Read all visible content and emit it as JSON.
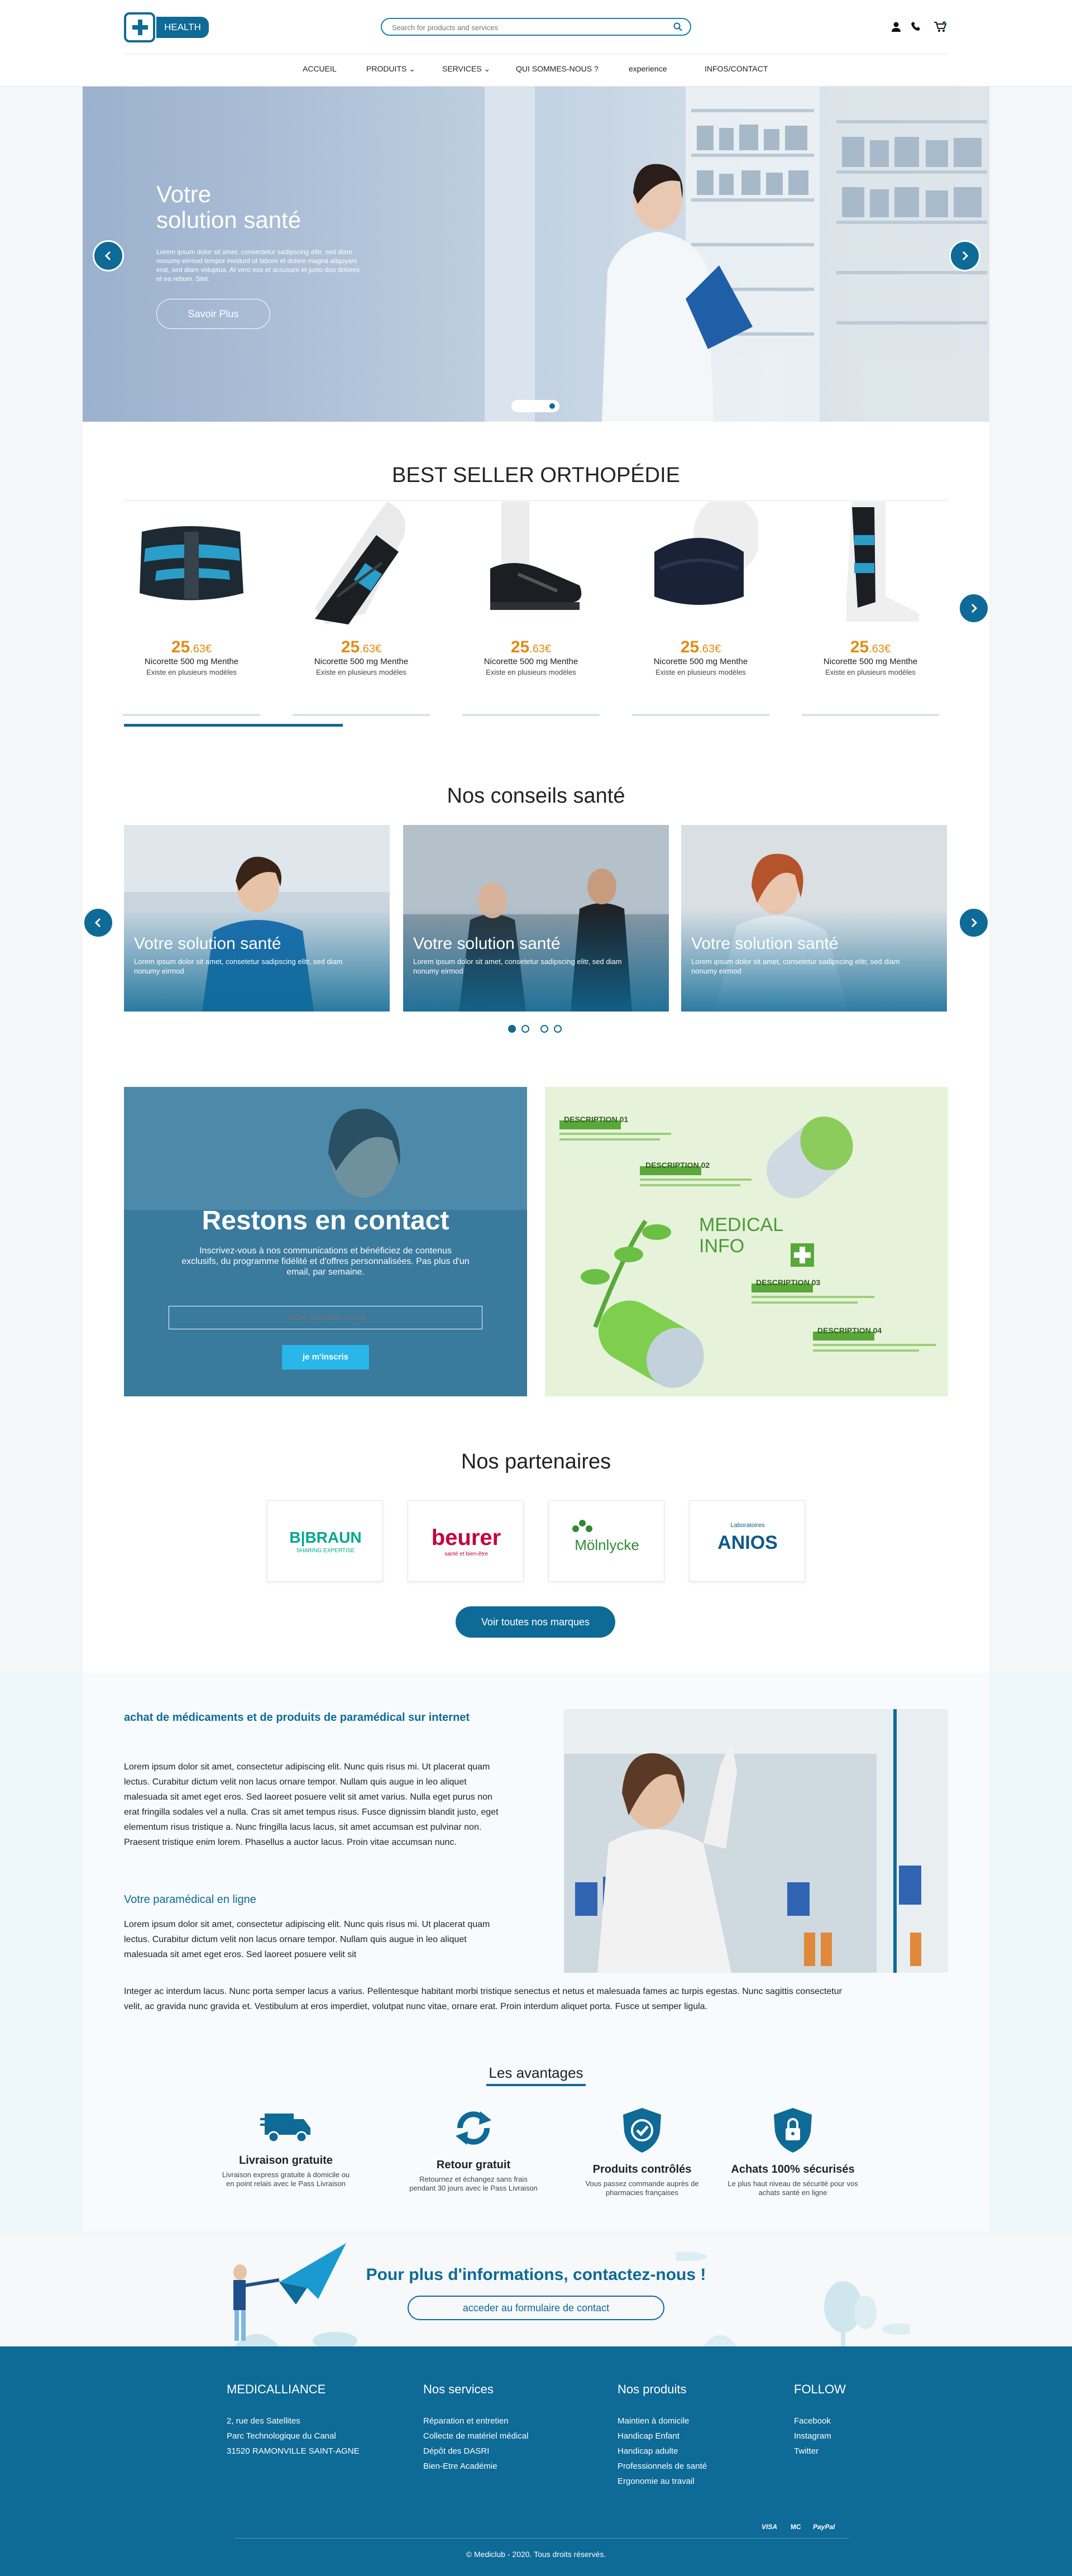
{
  "header": {
    "logo_text": "HEALTH",
    "search_placeholder": "Search for products and services",
    "icons": [
      "user-icon",
      "phone-icon",
      "cart-icon"
    ],
    "nav": [
      "ACCUEIL",
      "PRODUITS",
      "SERVICES",
      "QUI SOMMES-NOUS ?",
      "experience",
      "INFOS/CONTACT"
    ]
  },
  "hero": {
    "title_line1": "Votre",
    "title_line2": "solution santé",
    "text": "Lorem ipsum dolor sit amet, consectetur sadipscing elitr, sed diam nonumy eirmod tempor invidunt ut labore et dolore magna aliquyam erat, sed diam voluptua. At vero eos et accusam et justo duo dolores et ea rebum. Stet.",
    "button": "Savoir Plus"
  },
  "bestseller": {
    "title": "BEST SELLER ORTHOPÉDIE",
    "products": [
      {
        "price_int": "25",
        "price_dec": ".63€",
        "name": "Nicorette 500 mg Menthe",
        "sub": "Existe en plusieurs modèles",
        "image": "lumbar-belt"
      },
      {
        "price_int": "25",
        "price_dec": ".63€",
        "name": "Nicorette 500 mg Menthe",
        "sub": "Existe en plusieurs modèles",
        "image": "wrist-brace"
      },
      {
        "price_int": "25",
        "price_dec": ".63€",
        "name": "Nicorette 500 mg Menthe",
        "sub": "Existe en plusieurs modèles",
        "image": "post-op-shoe"
      },
      {
        "price_int": "25",
        "price_dec": ".63€",
        "name": "Nicorette 500 mg Menthe",
        "sub": "Existe en plusieurs modèles",
        "image": "cervical-collar"
      },
      {
        "price_int": "25",
        "price_dec": ".63€",
        "name": "Nicorette 500 mg Menthe",
        "sub": "Existe en plusieurs modèles",
        "image": "ankle-brace"
      }
    ]
  },
  "conseils": {
    "title": "Nos conseils santé",
    "cards": [
      {
        "title": "Votre solution santé",
        "text": "Lorem ipsum dolor sit amet, consetetur sadipscing elitr, sed diam nonumy eirmod"
      },
      {
        "title": "Votre solution santé",
        "text": "Lorem ipsum dolor sit amet, consetetur sadipscing elitr, sed diam nonumy eirmod"
      },
      {
        "title": "Votre solution santé",
        "text": "Lorem ipsum dolor sit amet, consetetur sadipscing elitr, sed diam nonumy eirmod"
      }
    ]
  },
  "contact": {
    "title": "Restons en contact",
    "text": "Inscrivez-vous à nos communications et bénéficiez de contenus exclusifs, du programme fidélité et d'offres personnalisées. Pas plus d'un email, par semaine.",
    "email_placeholder": "Votre adresse email",
    "button": "je m'inscris"
  },
  "medical_info": {
    "title_line1": "MEDICAL",
    "title_line2": "INFO",
    "descriptions": [
      "DESCRIPTION 01",
      "DESCRIPTION 02",
      "DESCRIPTION 03",
      "DESCRIPTION 04"
    ]
  },
  "partners": {
    "title": "Nos partenaires",
    "brands": [
      {
        "name": "B|BRAUN",
        "tagline": "SHARING EXPERTISE",
        "color": "#00a78e"
      },
      {
        "name": "beurer",
        "tagline": "santé et bien-être",
        "color": "#c3003e"
      },
      {
        "name": "Mölnlycke",
        "tagline": "",
        "color": "#2f8a34"
      },
      {
        "name": "ANIOS",
        "tagline": "Laboratoires",
        "color": "#0e5a8a"
      }
    ],
    "button": "Voir toutes nos marques"
  },
  "about": {
    "heading": "achat de médicaments et de produits de paramédical sur internet",
    "para1": "Lorem ipsum dolor sit amet, consectetur adipiscing elit. Nunc quis risus mi. Ut placerat quam lectus. Curabitur dictum velit non lacus ornare tempor. Nullam quis augue in leo aliquet malesuada sit amet eget eros. Sed laoreet posuere velit sit amet varius. Nulla eget purus non erat fringilla sodales vel a nulla. Cras sit amet tempus risus. Fusce dignissim blandit justo, eget elementum risus tristique a. Nunc fringilla lacus lacus, sit amet accumsan est pulvinar non. Praesent tristique enim lorem. Phasellus a auctor lacus. Proin vitae accumsan nunc.",
    "subheading": "Votre paramédical  en ligne",
    "para2": "Lorem ipsum dolor sit amet, consectetur adipiscing elit. Nunc quis risus mi. Ut placerat quam lectus. Curabitur dictum velit non lacus ornare tempor. Nullam quis augue in leo aliquet malesuada sit amet eget eros. Sed laoreet posuere velit sit",
    "para3": "Integer ac interdum lacus. Nunc porta semper lacus a varius. Pellentesque habitant morbi tristique senectus et netus et malesuada fames ac turpis egestas. Nunc sagittis consectetur velit, ac gravida nunc gravida et. Vestibulum at eros imperdiet, volutpat nunc vitae, ornare erat. Proin interdum aliquet porta. Fusce ut semper ligula."
  },
  "avantages": {
    "title": "Les avantages",
    "items": [
      {
        "icon": "truck-icon",
        "title": "Livraison gratuite",
        "text": "Livraison express gratuite à domicile ou en point relais avec le Pass Livraison"
      },
      {
        "icon": "refresh-icon",
        "title": "Retour gratuit",
        "text": "Retournez et échangez sans frais pendant 30 jours avec le Pass Livraison"
      },
      {
        "icon": "shield-check-icon",
        "title": "Produits contrôlés",
        "text": "Vous passez commande auprès de pharmacies françaises"
      },
      {
        "icon": "lock-icon",
        "title": "Achats 100% sécurisés",
        "text": "Le plus haut niveau de sécurité pour vos achats santé en ligne"
      }
    ]
  },
  "cta": {
    "title": "Pour plus d'informations, contactez-nous !",
    "button": "acceder au formulaire de contact"
  },
  "footer": {
    "col1": {
      "title": "MEDICALLIANCE",
      "lines": [
        "2, rue des Satellites",
        "Parc Technologique du Canal",
        "31520 RAMONVILLE SAINT-AGNE"
      ]
    },
    "col2": {
      "title": "Nos services",
      "links": [
        "Réparation et entretien",
        "Collecte de matériel médical",
        "Dépôt des DASRI",
        "Bien-Etre Académie"
      ]
    },
    "col3": {
      "title": "Nos produits",
      "links": [
        "Maintien à domicile",
        "Handicap Enfant",
        "Handicap adulte",
        "Professionnels de santé",
        "Ergonomie au travail"
      ]
    },
    "col4": {
      "title": "FOLLOW",
      "links": [
        "Facebook",
        "Instagram",
        "Twitter"
      ]
    },
    "payments": [
      "VISA",
      "MC",
      "PayPal"
    ],
    "copyright": "© Mediclub - 2020. Tous droits réservés."
  },
  "colors": {
    "primary": "#0e6a96",
    "accent": "#e38b13",
    "cta_button": "#29b6e8"
  }
}
